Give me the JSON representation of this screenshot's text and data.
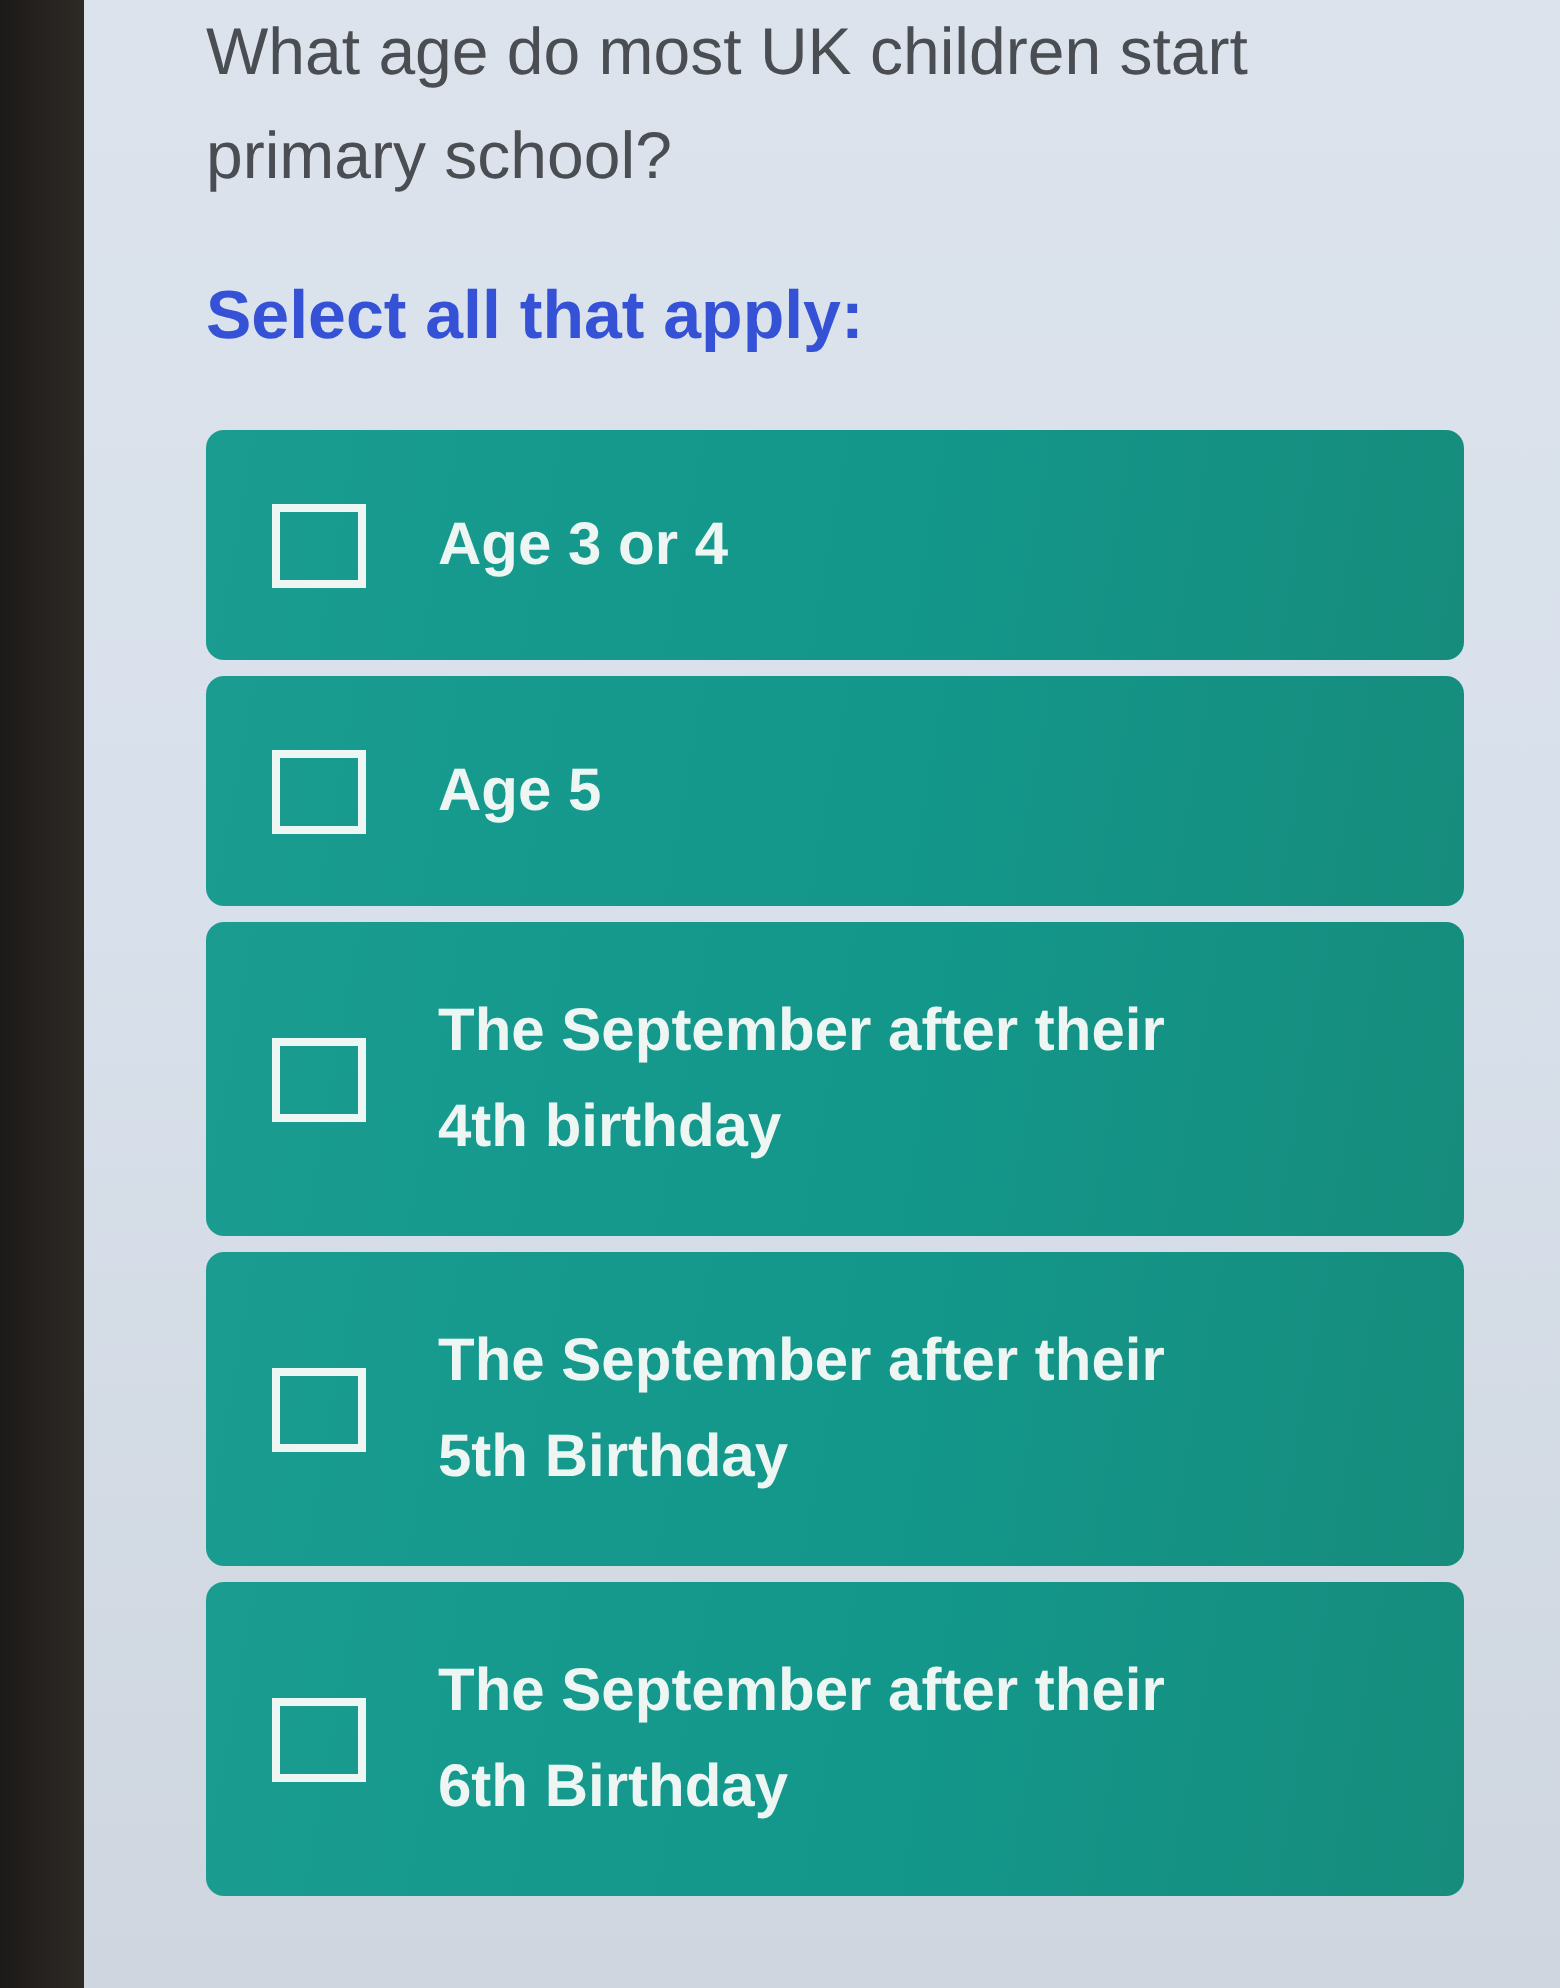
{
  "question": "What age do most UK children start primary school?",
  "instruction": "Select all that apply:",
  "options": [
    {
      "label": "Age 3 or 4",
      "checked": false
    },
    {
      "label": "Age 5",
      "checked": false
    },
    {
      "label": "The September after their 4th birthday",
      "checked": false
    },
    {
      "label": "The September after their 5th Birthday",
      "checked": false
    },
    {
      "label": "The September after their 6th Birthday",
      "checked": false
    }
  ]
}
